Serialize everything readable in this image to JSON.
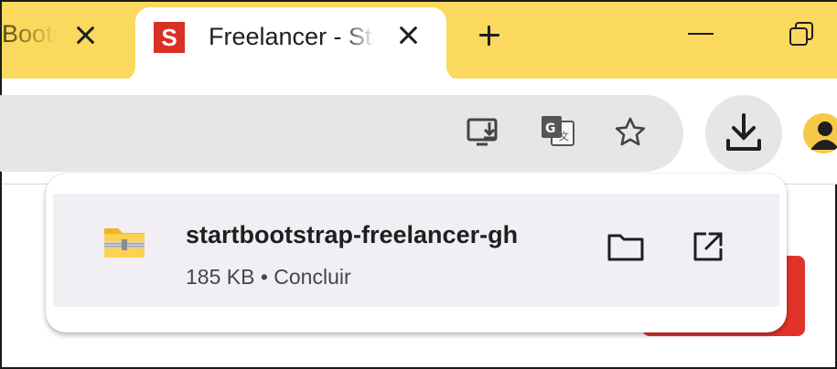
{
  "tabs": [
    {
      "title": "Bootstrap",
      "active": false
    },
    {
      "title": "Freelancer - Start Bootstrap",
      "active": true,
      "favicon_letter": "S",
      "favicon_color": "#d93025"
    }
  ],
  "colors": {
    "tabstrip": "#fbd95f",
    "omnibox": "#e6e6e6",
    "bubble_item": "#f2eff4",
    "page_button": "#e2332b"
  },
  "toolbar": {
    "icons": [
      "install-app-icon",
      "translate-icon",
      "bookmark-star-icon",
      "download-icon",
      "profile-avatar-icon"
    ]
  },
  "download": {
    "filename": "startbootstrap-freelancer-gh",
    "size": "185 KB",
    "status": "Concluir",
    "meta": "185 KB • Concluir"
  }
}
